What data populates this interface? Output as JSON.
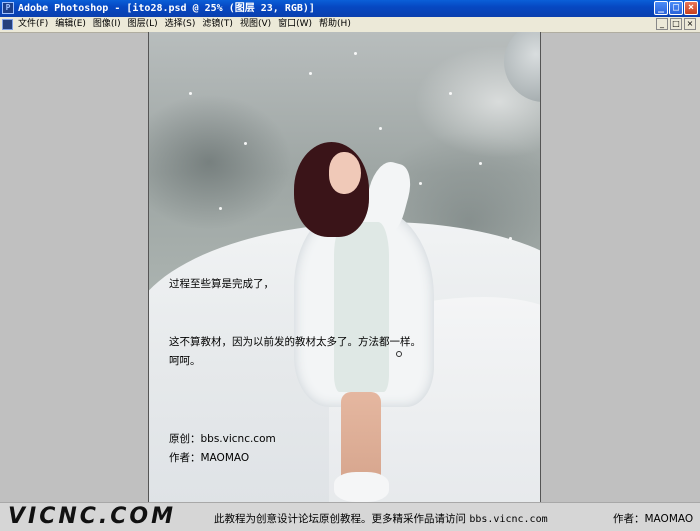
{
  "window": {
    "title": "Adobe Photoshop - [ito28.psd @ 25% (图层 23, RGB)]",
    "controls": {
      "minimize": "_",
      "maximize": "□",
      "close": "×"
    }
  },
  "menu": {
    "items": [
      {
        "label": "文件(F)"
      },
      {
        "label": "编辑(E)"
      },
      {
        "label": "图像(I)"
      },
      {
        "label": "图层(L)"
      },
      {
        "label": "选择(S)"
      },
      {
        "label": "滤镜(T)"
      },
      {
        "label": "视图(V)"
      },
      {
        "label": "窗口(W)"
      },
      {
        "label": "帮助(H)"
      }
    ],
    "doc_controls": {
      "minimize": "_",
      "maximize": "□",
      "close": "×"
    }
  },
  "canvas": {
    "text_line_1": "过程至些算是完成了，",
    "text_line_2": "这不算教材，因为以前发的教材太多了。方法都一样。",
    "text_line_3": "呵呵。",
    "credit_original": "原创：bbs.vicnc.com",
    "credit_author": "作者：MAOMAO"
  },
  "banner": {
    "logo": "VICNC.COM",
    "message": "此教程为创意设计论坛原创教程。更多精采作品请访问",
    "url": "bbs.vicnc.com",
    "author": "作者：MAOMAO"
  }
}
